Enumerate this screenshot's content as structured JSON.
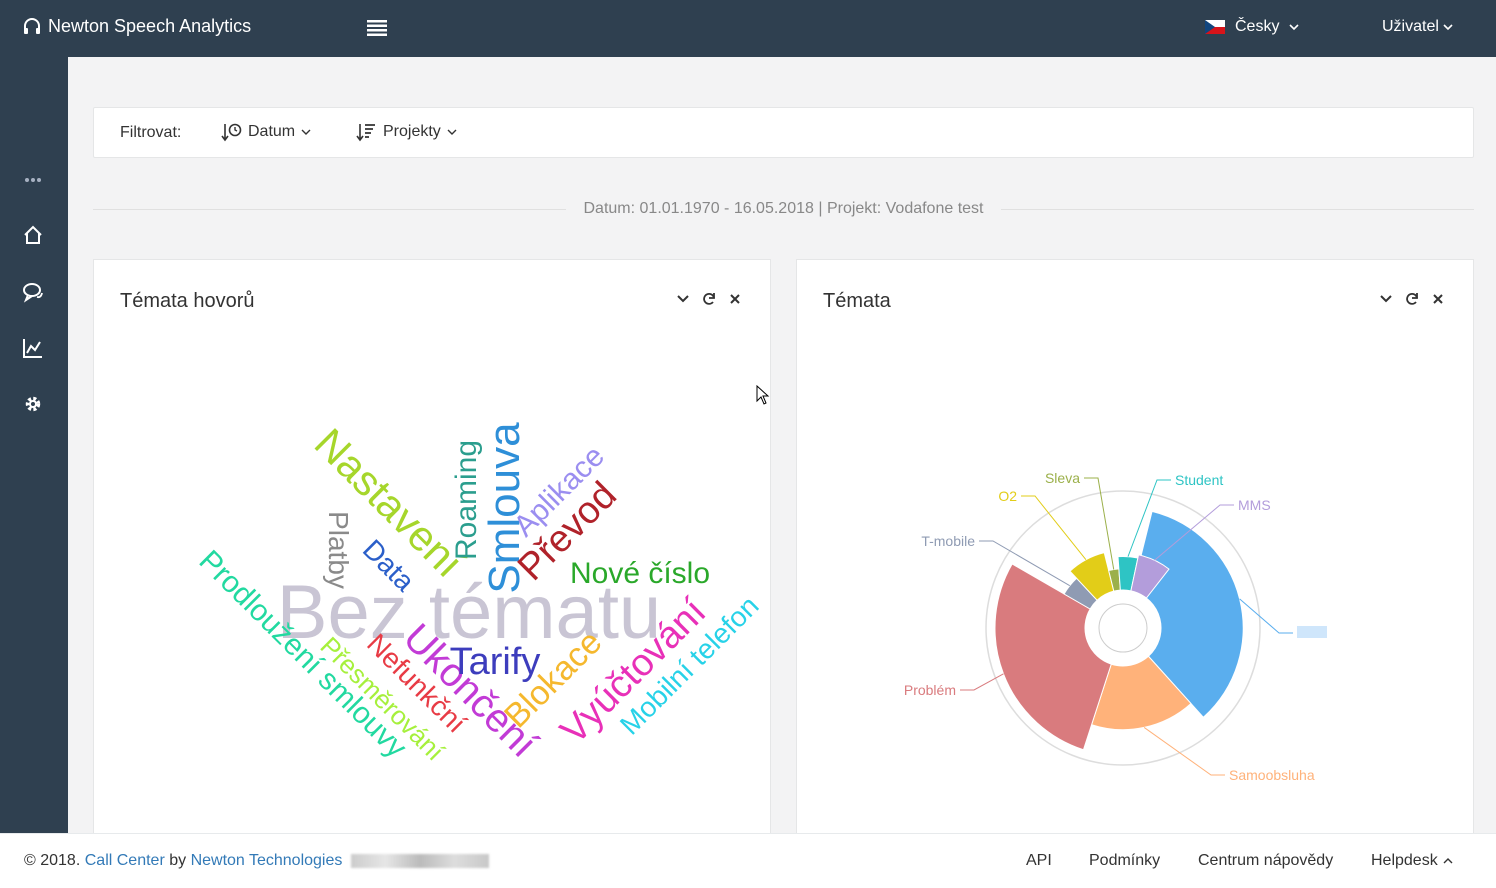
{
  "header": {
    "app_title": "Newton Speech Analytics",
    "language": "Česky",
    "user": "Uživatel"
  },
  "filter": {
    "label": "Filtrovat:",
    "date_button": "Datum",
    "projects_button": "Projekty"
  },
  "range_text": "Datum: 01.01.1970 - 16.05.2018 | Projekt: Vodafone test",
  "panels": {
    "left_title": "Témata hovorů",
    "right_title": "Témata"
  },
  "wordcloud": [
    {
      "text": "Bez tématu",
      "color": "#c9c5d4"
    },
    {
      "text": "Nastavení",
      "color": "#a6d62b"
    },
    {
      "text": "Smlouva",
      "color": "#2e8fd8"
    },
    {
      "text": "Roaming",
      "color": "#2b9e8e"
    },
    {
      "text": "Aplikace",
      "color": "#9b8ef0"
    },
    {
      "text": "Převod",
      "color": "#b0222a"
    },
    {
      "text": "Platby",
      "color": "#8a8a8a"
    },
    {
      "text": "Data",
      "color": "#2b5fc9"
    },
    {
      "text": "Nové číslo",
      "color": "#2aa82a"
    },
    {
      "text": "Prodloužení smlouvy",
      "color": "#22d9a0"
    },
    {
      "text": "Přesměrování",
      "color": "#a6f03c"
    },
    {
      "text": "Nefunkční",
      "color": "#e83b45"
    },
    {
      "text": "Ukončení",
      "color": "#c23bd6"
    },
    {
      "text": "Tarify",
      "color": "#3d3dbd"
    },
    {
      "text": "Blokace",
      "color": "#f5b82e"
    },
    {
      "text": "Vyúčtování",
      "color": "#e830b8"
    },
    {
      "text": "Mobilní telefon",
      "color": "#27d2e8"
    }
  ],
  "chart_data": {
    "type": "pie",
    "subtype": "nightingale-rose",
    "categories": [
      "",
      "Samoobsluha",
      "Problém",
      "T-mobile",
      "O2",
      "Sleva",
      "Student",
      "MMS"
    ],
    "values": [
      30,
      18,
      36,
      4,
      7,
      2,
      5,
      6
    ],
    "colors": [
      "#5aaeee",
      "#ffb27a",
      "#d97b7e",
      "#8f9bb3",
      "#e2cd18",
      "#9bb04a",
      "#2ec4c4",
      "#b39ddb"
    ],
    "legend": "none"
  },
  "footer": {
    "copyright": "© 2018.",
    "call_center": "Call Center",
    "by": "by",
    "company": "Newton Technologies",
    "api": "API",
    "terms": "Podmínky",
    "help_center": "Centrum nápovědy",
    "helpdesk": "Helpdesk"
  }
}
